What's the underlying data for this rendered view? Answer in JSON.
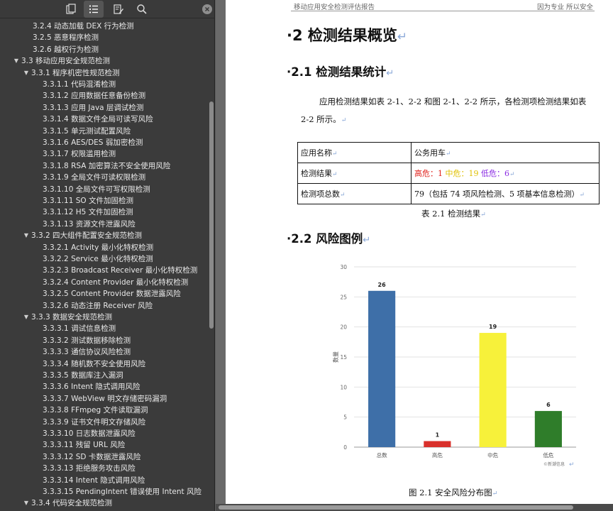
{
  "sidebar": {
    "toc": [
      {
        "label": "3.2.4 动态加载 DEX 行为检测",
        "level": 2,
        "toggle": ""
      },
      {
        "label": "3.2.5 恶意程序检测",
        "level": 2,
        "toggle": ""
      },
      {
        "label": "3.2.6 越权行为检测",
        "level": 2,
        "toggle": ""
      },
      {
        "label": "3.3 移动应用安全规范检测",
        "level": 0,
        "toggle": "▼"
      },
      {
        "label": "3.3.1 程序机密性规范检测",
        "level": 1,
        "toggle": "▼"
      },
      {
        "label": "3.3.1.1 代码混淆检测",
        "level": 3,
        "toggle": ""
      },
      {
        "label": "3.3.1.2 应用数据任意备份检测",
        "level": 3,
        "toggle": ""
      },
      {
        "label": "3.3.1.3 应用 Java 层调试检测",
        "level": 3,
        "toggle": ""
      },
      {
        "label": "3.3.1.4 数据文件全局可读写风险",
        "level": 3,
        "toggle": ""
      },
      {
        "label": "3.3.1.5 单元测试配置风险",
        "level": 3,
        "toggle": ""
      },
      {
        "label": "3.3.1.6 AES/DES 弱加密检测",
        "level": 3,
        "toggle": ""
      },
      {
        "label": "3.3.1.7 权限滥用检测",
        "level": 3,
        "toggle": ""
      },
      {
        "label": "3.3.1.8 RSA 加密算法不安全使用风险",
        "level": 3,
        "toggle": ""
      },
      {
        "label": "3.3.1.9 全局文件可读权限检测",
        "level": 3,
        "toggle": ""
      },
      {
        "label": "3.3.1.10 全局文件可写权限检测",
        "level": 3,
        "toggle": ""
      },
      {
        "label": "3.3.1.11 SO 文件加固检测",
        "level": 3,
        "toggle": ""
      },
      {
        "label": "3.3.1.12 H5 文件加固检测",
        "level": 3,
        "toggle": ""
      },
      {
        "label": "3.3.1.13 资源文件泄露风险",
        "level": 3,
        "toggle": ""
      },
      {
        "label": "3.3.2 四大组件配置安全规范检测",
        "level": 1,
        "toggle": "▼"
      },
      {
        "label": "3.3.2.1 Activity 最小化特权检测",
        "level": 3,
        "toggle": ""
      },
      {
        "label": "3.3.2.2 Service 最小化特权检测",
        "level": 3,
        "toggle": ""
      },
      {
        "label": "3.3.2.3 Broadcast Receiver 最小化特权检测",
        "level": 3,
        "toggle": ""
      },
      {
        "label": "3.3.2.4 Content Provider 最小化特权检测",
        "level": 3,
        "toggle": ""
      },
      {
        "label": "3.3.2.5 Content Provider 数据泄露风险",
        "level": 3,
        "toggle": ""
      },
      {
        "label": "3.3.2.6 动态注册 Receiver 风险",
        "level": 3,
        "toggle": ""
      },
      {
        "label": "3.3.3 数据安全规范检测",
        "level": 1,
        "toggle": "▼"
      },
      {
        "label": "3.3.3.1 调试信息检测",
        "level": 3,
        "toggle": ""
      },
      {
        "label": "3.3.3.2 测试数据移除检测",
        "level": 3,
        "toggle": ""
      },
      {
        "label": "3.3.3.3 通信协议风险检测",
        "level": 3,
        "toggle": ""
      },
      {
        "label": "3.3.3.4 随机数不安全使用风险",
        "level": 3,
        "toggle": ""
      },
      {
        "label": "3.3.3.5 数据库注入漏洞",
        "level": 3,
        "toggle": ""
      },
      {
        "label": "3.3.3.6 Intent 隐式调用风险",
        "level": 3,
        "toggle": ""
      },
      {
        "label": "3.3.3.7 WebView 明文存储密码漏洞",
        "level": 3,
        "toggle": ""
      },
      {
        "label": "3.3.3.8 FFmpeg 文件读取漏洞",
        "level": 3,
        "toggle": ""
      },
      {
        "label": "3.3.3.9 证书文件明文存储风险",
        "level": 3,
        "toggle": ""
      },
      {
        "label": "3.3.3.10 日志数据泄露风险",
        "level": 3,
        "toggle": ""
      },
      {
        "label": "3.3.3.11 残留 URL 风险",
        "level": 3,
        "toggle": ""
      },
      {
        "label": "3.3.3.12 SD 卡数据泄露风险",
        "level": 3,
        "toggle": ""
      },
      {
        "label": "3.3.3.13 拒绝服务攻击风险",
        "level": 3,
        "toggle": ""
      },
      {
        "label": "3.3.3.14 Intent 隐式调用风险",
        "level": 3,
        "toggle": ""
      },
      {
        "label": "3.3.3.15 PendingIntent 错误使用 Intent 风险",
        "level": 3,
        "toggle": ""
      },
      {
        "label": "3.3.4 代码安全规范检测",
        "level": 1,
        "toggle": "▼"
      }
    ]
  },
  "document": {
    "header_left": "移动应用安全检测评估报告",
    "header_right": "因为专业 所以安全",
    "h1_bullet": "·",
    "h1": "2  检测结果概览",
    "para_mark": "↵",
    "h2_1": "2.1  检测结果统计",
    "para1": "应用检测结果如表 2-1、2-2 和图 2-1、2-2 所示，各检测项检测结果如表",
    "para2": "2-2 所示。",
    "table": {
      "r1_label": "应用名称",
      "r1_value": "公务用车",
      "r2_label": "检测结果",
      "high_label": "高危：1",
      "mid_label": "中危：19",
      "low_label": "低危：6",
      "r3_label": "检测项总数",
      "r3_value": "79（包括 74 项风险检测、5 项基本信息检测）"
    },
    "caption1": "表 2.1  检测结果",
    "h2_2": "2.2  风险图例",
    "caption2": "图 2.1  安全风险分布图"
  },
  "chart_data": {
    "type": "bar",
    "categories": [
      "总数",
      "高危",
      "中危",
      "低危"
    ],
    "values": [
      26,
      1,
      19,
      6
    ],
    "colors": [
      "#3e6fa8",
      "#d9302b",
      "#f7f13a",
      "#2f7d2a"
    ],
    "ylabel": "数量",
    "ylim": [
      0,
      30
    ],
    "yticks": [
      0,
      5,
      10,
      15,
      20,
      25,
      30
    ],
    "grid": true,
    "watermark": "©新潮信息"
  }
}
